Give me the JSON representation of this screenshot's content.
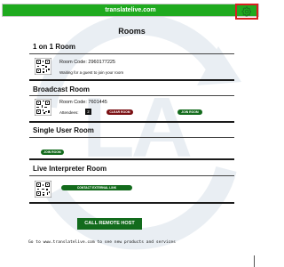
{
  "header": {
    "title": "translatelive.com",
    "background_color": "#1faa1f",
    "settings_icon": "gear-icon",
    "settings_highlight_color": "#d72020"
  },
  "watermark": {
    "text": "LA"
  },
  "page_title": "Rooms",
  "rooms": {
    "one_on_one": {
      "title": "1 on 1 Room",
      "room_code_label": "Room Code: 2960177225",
      "status": "Waiting for a guest to join your room"
    },
    "broadcast": {
      "title": "Broadcast Room",
      "room_code_label": "Room Code: 7601445",
      "attendees_label": "Attendees:",
      "attendees_count": "2",
      "clear_button": "CLEAR ROOM",
      "join_button": "JOIN ROOM"
    },
    "single_user": {
      "title": "Single User Room",
      "join_button": "JOIN ROOM"
    },
    "live_interpreter": {
      "title": "Live Interpreter Room",
      "contact_button": "CONTACT EXTERNAL LINK"
    }
  },
  "call_button": "CALL REMOTE HOST",
  "footer": "Go to www.translatelive.com to see new products and services",
  "colors": {
    "button_green": "#136b1c",
    "button_red": "#7a0f12"
  }
}
